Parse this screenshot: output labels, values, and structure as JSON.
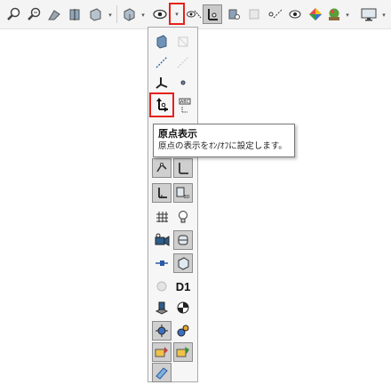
{
  "toolbar": {
    "icons": [
      "zoom-to-fit-icon",
      "zoom-to-area-icon",
      "previous-view-icon",
      "section-view-icon",
      "view-orientation-icon",
      "display-style-icon",
      "hide-show-items-icon",
      "edit-appearance-icon",
      "apply-scene-icon",
      "view-settings-icon",
      "monitor-icon"
    ]
  },
  "flyout": {
    "label_d1": "D1"
  },
  "tooltip": {
    "title": "原点表示",
    "description": "原点の表示をｵﾝ/ｵﾌに設定します。"
  },
  "colors": {
    "highlight": "#e5211b",
    "pressed": "#cfcfcf"
  }
}
